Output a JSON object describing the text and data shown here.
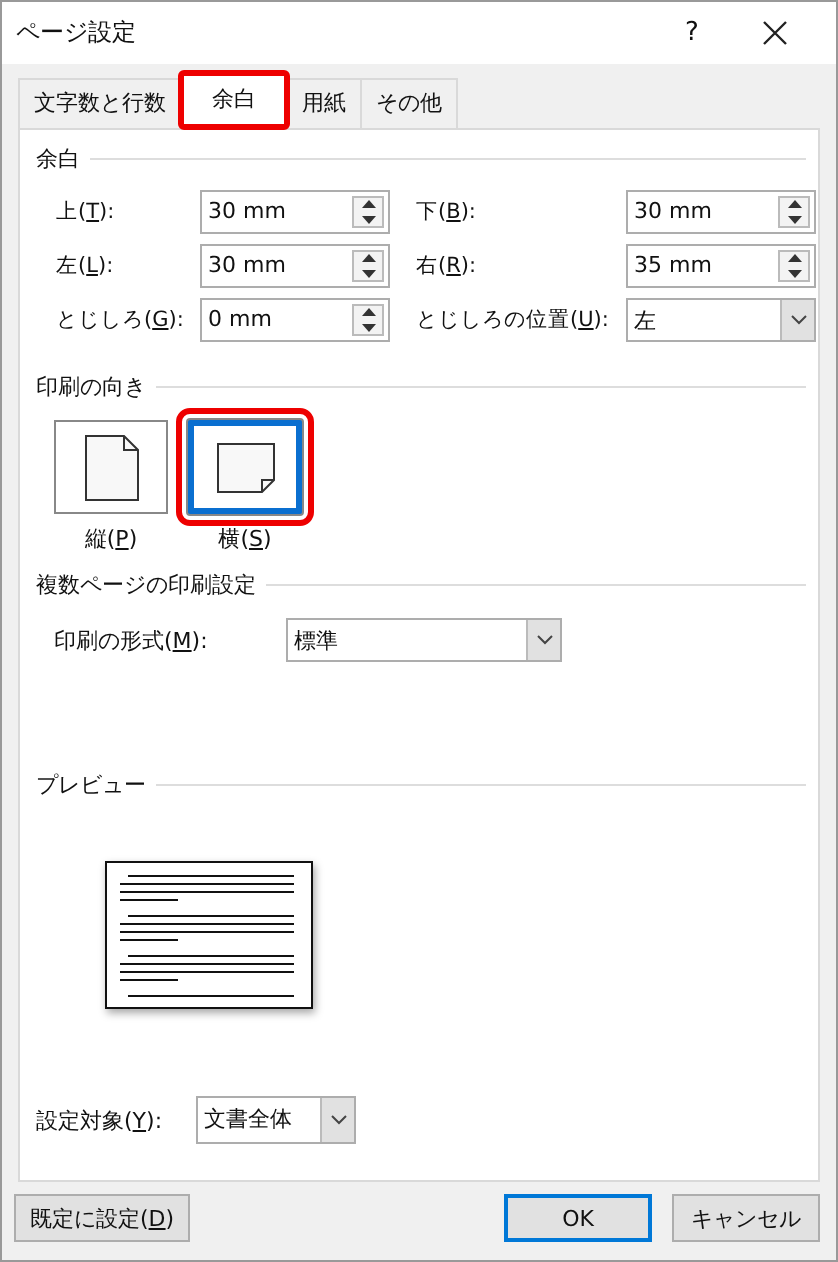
{
  "window": {
    "title": "ページ設定",
    "help": "?"
  },
  "tabs": [
    {
      "label": "文字数と行数",
      "selected": false,
      "highlighted": false
    },
    {
      "label": "余白",
      "selected": true,
      "highlighted": true
    },
    {
      "label": "用紙",
      "selected": false,
      "highlighted": false
    },
    {
      "label": "その他",
      "selected": false,
      "highlighted": false
    }
  ],
  "margins": {
    "title": "余白",
    "fields": [
      {
        "label": "上(",
        "key": "T",
        "after": "):",
        "value": "30 mm",
        "kind": "spin"
      },
      {
        "label": "下(",
        "key": "B",
        "after": "):",
        "value": "30 mm",
        "kind": "spin"
      },
      {
        "label": "左(",
        "key": "L",
        "after": "):",
        "value": "30 mm",
        "kind": "spin"
      },
      {
        "label": "右(",
        "key": "R",
        "after": "):",
        "value": "35 mm",
        "kind": "spin"
      },
      {
        "label": "とじしろ(",
        "key": "G",
        "after": "):",
        "value": "0 mm",
        "kind": "spin"
      },
      {
        "label": "とじしろの位置(",
        "key": "U",
        "after": "):",
        "value": "左",
        "kind": "select"
      }
    ]
  },
  "orientation": {
    "title": "印刷の向き",
    "options": [
      {
        "label": "縦(",
        "key": "P",
        "after": ")",
        "kind": "portrait",
        "selected": false,
        "highlighted": false
      },
      {
        "label": "横(",
        "key": "S",
        "after": ")",
        "kind": "landscape",
        "selected": true,
        "highlighted": true
      }
    ]
  },
  "pages": {
    "title": "複数ページの印刷設定",
    "label": "印刷の形式(",
    "key": "M",
    "after": "):",
    "value": "標準"
  },
  "preview": {
    "title": "プレビュー",
    "apply_to": {
      "label": "設定対象(",
      "key": "Y",
      "after": "):",
      "value": "文書全体"
    }
  },
  "buttons": [
    {
      "label": "既定に設定(",
      "key": "D",
      "after": ")",
      "default": false
    },
    {
      "label": "OK",
      "default": true
    },
    {
      "label": "キャンセル",
      "default": false
    }
  ]
}
